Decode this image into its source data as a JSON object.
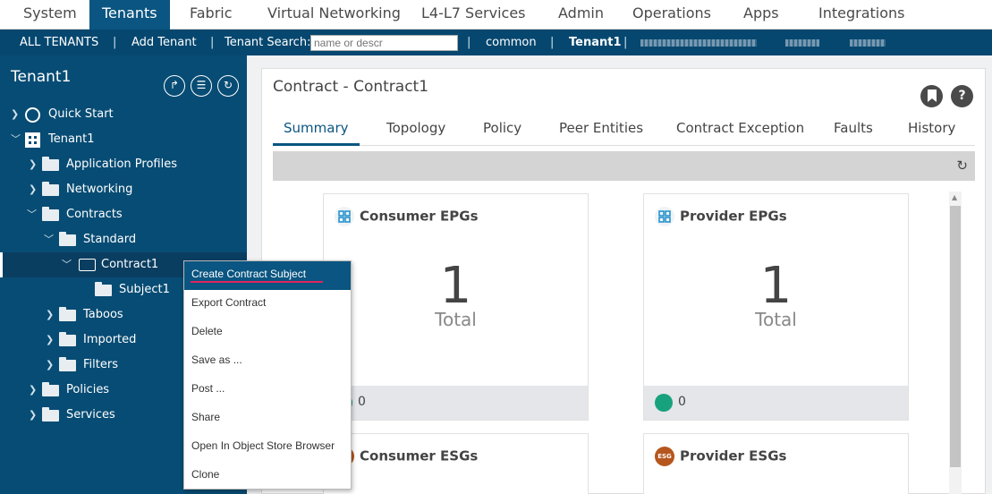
{
  "topnav": {
    "tabs": [
      {
        "label": "System"
      },
      {
        "label": "Tenants"
      },
      {
        "label": "Fabric"
      },
      {
        "label": "Virtual Networking"
      },
      {
        "label": "L4-L7 Services"
      },
      {
        "label": "Admin"
      },
      {
        "label": "Operations"
      },
      {
        "label": "Apps"
      },
      {
        "label": "Integrations"
      }
    ],
    "active": "Tenants"
  },
  "subnav": {
    "all_tenants": "ALL TENANTS",
    "add_tenant": "Add Tenant",
    "search_label": "Tenant Search:",
    "search_placeholder": "name or descr",
    "common": "common",
    "current_tenant": "Tenant1"
  },
  "left": {
    "title": "Tenant1",
    "tree": [
      {
        "label": "Quick Start"
      },
      {
        "label": "Tenant1"
      },
      {
        "label": "Application Profiles"
      },
      {
        "label": "Networking"
      },
      {
        "label": "Contracts"
      },
      {
        "label": "Standard"
      },
      {
        "label": "Contract1"
      },
      {
        "label": "Subject1"
      },
      {
        "label": "Taboos"
      },
      {
        "label": "Imported"
      },
      {
        "label": "Filters"
      },
      {
        "label": "Policies"
      },
      {
        "label": "Services"
      }
    ]
  },
  "main": {
    "title": "Contract - Contract1",
    "tabs": [
      {
        "label": "Summary"
      },
      {
        "label": "Topology"
      },
      {
        "label": "Policy"
      },
      {
        "label": "Peer Entities"
      },
      {
        "label": "Contract Exception"
      },
      {
        "label": "Faults"
      },
      {
        "label": "History"
      }
    ],
    "active_tab": "Summary",
    "cards": [
      {
        "title": "Consumer EPGs",
        "count": "1",
        "count_label": "Total",
        "footer_value": "0"
      },
      {
        "title": "Provider EPGs",
        "count": "1",
        "count_label": "Total",
        "footer_value": "0"
      },
      {
        "title": "Consumer ESGs"
      },
      {
        "title": "Provider ESGs",
        "badge": "ESG"
      }
    ]
  },
  "context_menu": {
    "items": [
      {
        "label": "Create Contract Subject"
      },
      {
        "label": "Export Contract"
      },
      {
        "label": "Delete"
      },
      {
        "label": "Save as ..."
      },
      {
        "label": "Post ..."
      },
      {
        "label": "Share"
      },
      {
        "label": "Open In Object Store Browser"
      },
      {
        "label": "Clone"
      }
    ],
    "highlighted": "Create Contract Subject"
  },
  "colors": {
    "nav_active": "#0a5581",
    "subnav_bg": "#05476f",
    "left_panel_bg": "#074c74",
    "accent_underline": "#e0245e",
    "fault_green": "#17a27d"
  }
}
